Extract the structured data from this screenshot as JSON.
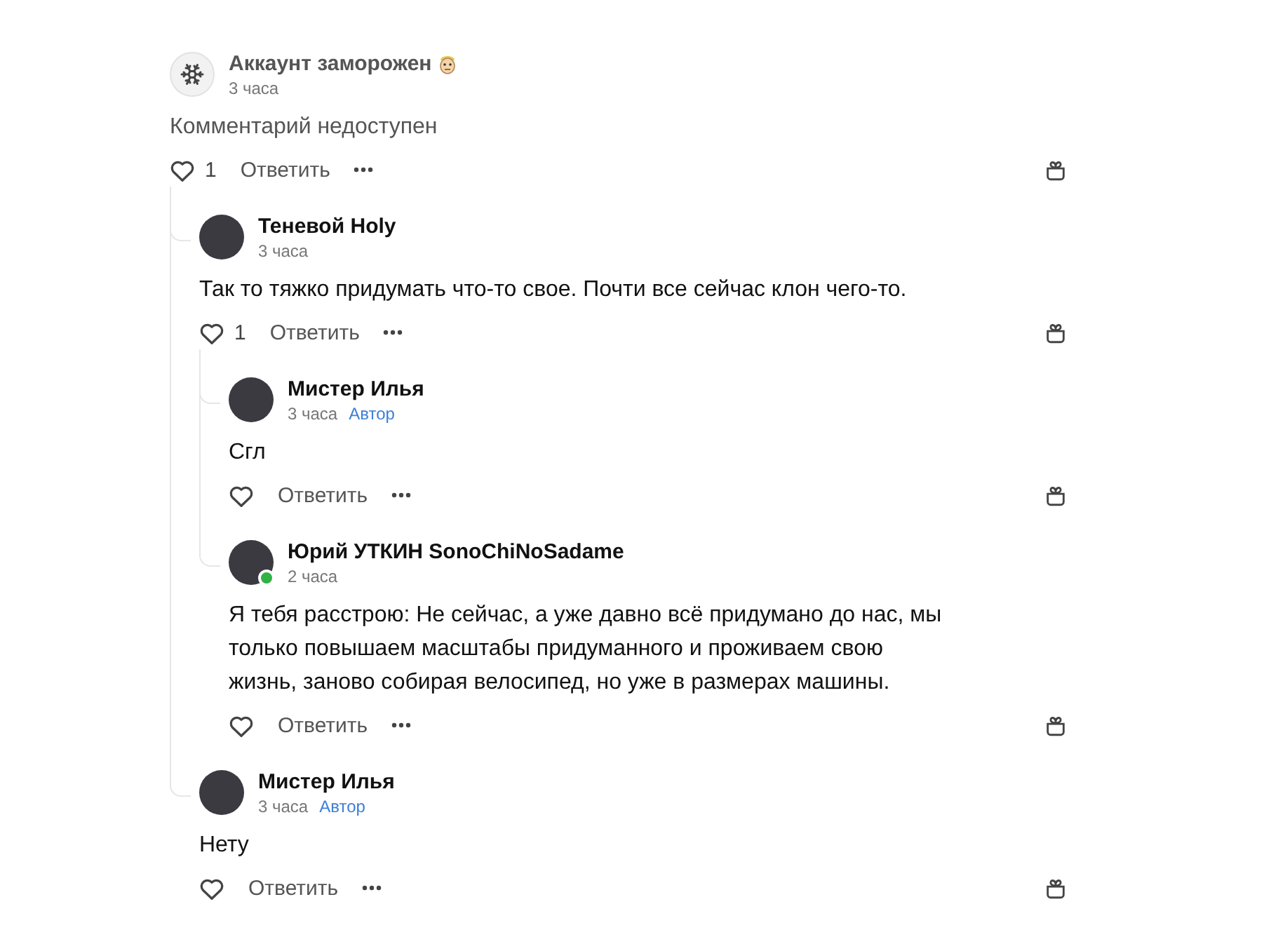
{
  "comments": [
    {
      "kind": "frozen",
      "author": "Аккаунт заморожен",
      "time": "3 часа",
      "text": "Комментарий недоступен",
      "likes": "1",
      "reply": "Ответить",
      "online": false,
      "children": [
        {
          "kind": "user",
          "author": "Теневой Holy",
          "time": "3 часа",
          "text": "Так то тяжко придумать что-то свое. Почти все сейчас клон чего-то.",
          "likes": "1",
          "reply": "Ответить",
          "online": false,
          "children": [
            {
              "kind": "user",
              "author": "Мистер Илья",
              "time": "3 часа",
              "badge": "Автор",
              "text": "Сгл",
              "reply": "Ответить",
              "online": false
            },
            {
              "kind": "user",
              "author": "Юрий УТКИН SonoChiNoSadame",
              "time": "2 часа",
              "text": "Я тебя расстрою: Не сейчас, а уже давно всё придумано до нас, мы только повышаем масштабы придуманного и проживаем свою жизнь, заново собирая велосипед, но уже в размерах машины.",
              "reply": "Ответить",
              "online": true
            }
          ]
        },
        {
          "kind": "user",
          "author": "Мистер Илья",
          "time": "3 часа",
          "badge": "Автор",
          "text": "Нету",
          "reply": "Ответить",
          "online": false
        }
      ]
    }
  ]
}
